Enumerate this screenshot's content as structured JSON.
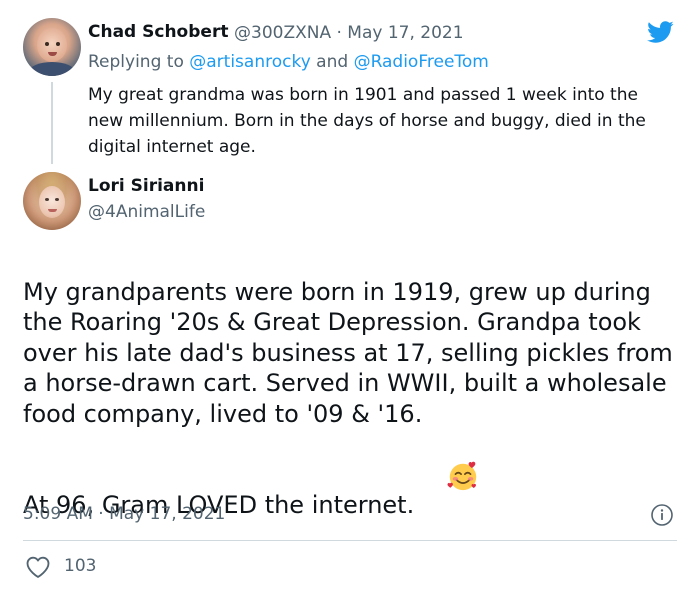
{
  "parent_tweet": {
    "name": "Chad Schobert",
    "meta": "@300ZXNA · May 17, 2021",
    "replying_prefix": "Replying to ",
    "replying_user_1": "@artisanrocky",
    "replying_and": " and ",
    "replying_user_2": "@RadioFreeTom",
    "text": "My great grandma was born in 1901 and passed 1 week into the new millennium.  Born in the days of horse and buggy, died in the digital internet age."
  },
  "main_tweet": {
    "name": "Lori Sirianni",
    "handle": "@4AnimalLife",
    "paragraph_1": "My grandparents were born in 1919, grew up during the Roaring '20s & Great Depression. Grandpa took over his late dad's business at 17, selling pickles from a horse-drawn cart. Served in WWII, built a wholesale food company, lived to '09 & '16.",
    "paragraph_2": "At 96, Gram LOVED the internet.",
    "emoji": "smiling-face-with-hearts",
    "timestamp": "5:09 AM · May 17, 2021",
    "likes": "103"
  },
  "colors": {
    "text": "#0f1419",
    "muted": "#536471",
    "link": "#1d9bf0",
    "divider": "#cfd9de"
  }
}
